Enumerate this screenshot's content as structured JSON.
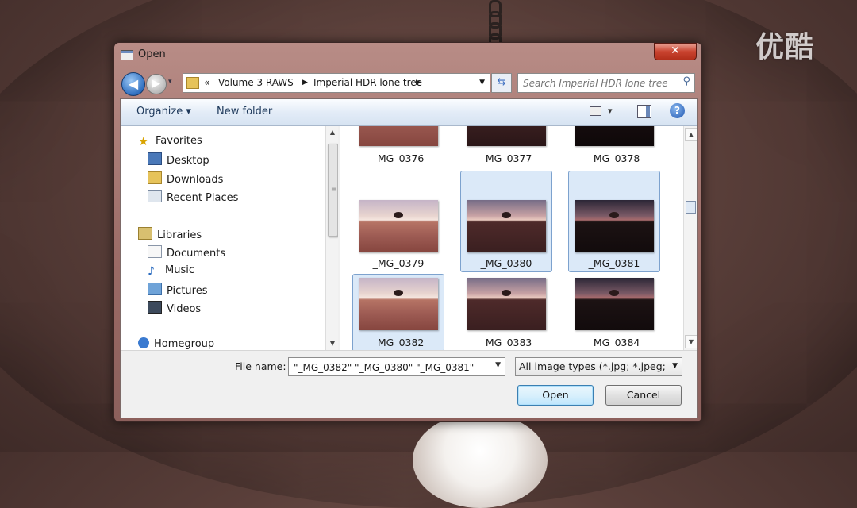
{
  "watermark": "优酷",
  "window": {
    "title": "Open",
    "close_glyph": "✕"
  },
  "address": {
    "chevrons": "«",
    "crumbs": [
      "Volume 3 RAWS",
      "Imperial HDR lone tree"
    ],
    "search_placeholder": "Search Imperial HDR lone tree"
  },
  "toolbar": {
    "organize": "Organize ▾",
    "new_folder": "New folder",
    "views_arrow": "▾",
    "help": "?"
  },
  "nav": {
    "favorites": "Favorites",
    "desktop": "Desktop",
    "downloads": "Downloads",
    "recent": "Recent Places",
    "libraries": "Libraries",
    "documents": "Documents",
    "music": "Music",
    "pictures": "Pictures",
    "videos": "Videos",
    "homegroup": "Homegroup"
  },
  "files": [
    {
      "name": "_MG_0376",
      "selected": false
    },
    {
      "name": "_MG_0377",
      "selected": false
    },
    {
      "name": "_MG_0378",
      "selected": false
    },
    {
      "name": "_MG_0379",
      "selected": false
    },
    {
      "name": "_MG_0380",
      "selected": true
    },
    {
      "name": "_MG_0381",
      "selected": true
    },
    {
      "name": "_MG_0382",
      "selected": true
    },
    {
      "name": "_MG_0383",
      "selected": false
    },
    {
      "name": "_MG_0384",
      "selected": false
    }
  ],
  "footer": {
    "file_name_label": "File name:",
    "file_name_value": "\"_MG_0382\" \"_MG_0380\" \"_MG_0381\"",
    "file_type": "All image types (*.jpg; *.jpeg; *.",
    "open": "Open",
    "cancel": "Cancel"
  },
  "colors": {
    "selection": "#dbe9f8",
    "selection_border": "#7da2ce",
    "close_button": "#c9432f"
  }
}
